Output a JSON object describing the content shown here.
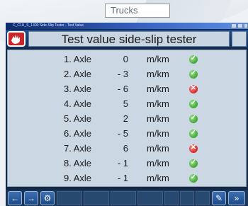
{
  "caption": "Trucks",
  "window": {
    "titlebar_text": "C_C1U_S_1400 Side-Slip Tester - Test Value"
  },
  "header": {
    "title": "Test value side-slip tester",
    "icon": "hand-icon"
  },
  "rows": [
    {
      "axle": "1. Axle",
      "value": "0",
      "unit": "m/km",
      "status": "ok"
    },
    {
      "axle": "2. Axle",
      "value": "- 3",
      "unit": "m/km",
      "status": "ok"
    },
    {
      "axle": "3. Axle",
      "value": "- 6",
      "unit": "m/km",
      "status": "fail"
    },
    {
      "axle": "4. Axle",
      "value": "5",
      "unit": "m/km",
      "status": "ok"
    },
    {
      "axle": "5. Axle",
      "value": "2",
      "unit": "m/km",
      "status": "ok"
    },
    {
      "axle": "6. Axle",
      "value": "- 5",
      "unit": "m/km",
      "status": "ok"
    },
    {
      "axle": "7. Axle",
      "value": "6",
      "unit": "m/km",
      "status": "fail"
    },
    {
      "axle": "8. Axle",
      "value": "- 1",
      "unit": "m/km",
      "status": "ok"
    },
    {
      "axle": "9. Axle",
      "value": "- 1",
      "unit": "m/km",
      "status": "ok"
    }
  ],
  "footer": {
    "left_buttons": [
      "back-arrow-icon",
      "forward-arrow-icon",
      "settings-icon"
    ],
    "right_buttons": [
      "disabled-icon",
      "disabled-icon",
      "disabled-icon",
      "tool-icon",
      "next-icon"
    ]
  },
  "colors": {
    "ok": "#3fa733",
    "fail": "#d62424",
    "header": "#1f4e8c"
  }
}
